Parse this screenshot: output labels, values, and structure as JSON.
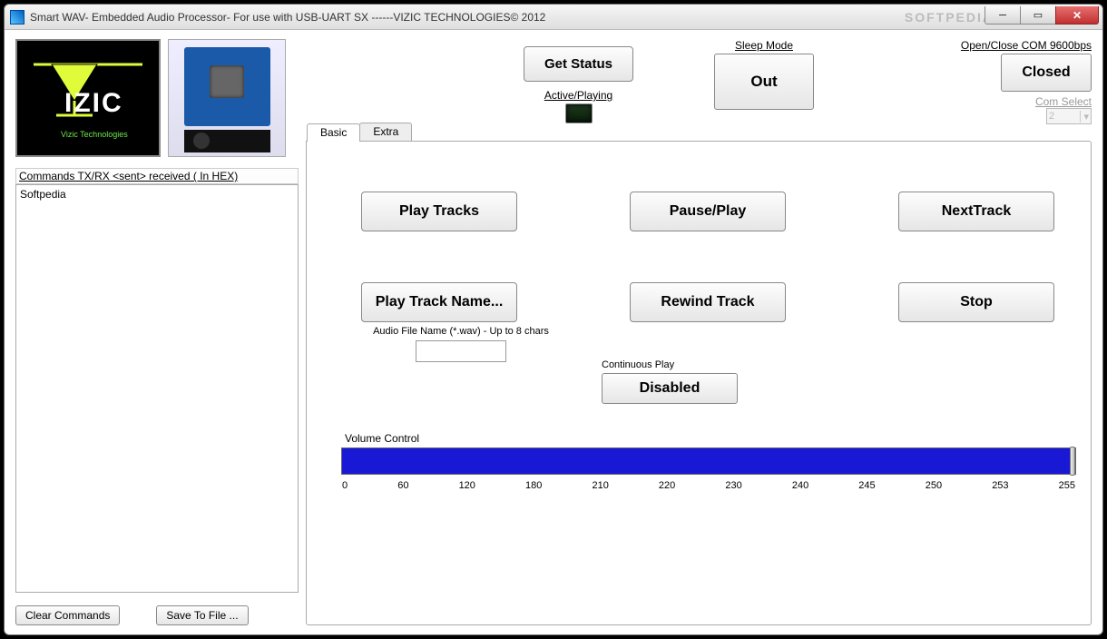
{
  "window": {
    "title": "Smart WAV- Embedded Audio Processor- For use with USB-UART SX ------VIZIC TECHNOLOGIES© 2012",
    "watermark": "SOFTPEDIA"
  },
  "logo": {
    "company_line1": "VIZIC",
    "company_line2": "Vizic Technologies"
  },
  "commands": {
    "label": "Commands TX/RX  <sent> received ( In HEX)",
    "text": "Softpedia",
    "clear_label": "Clear Commands",
    "save_label": "Save To File ..."
  },
  "top": {
    "get_status_label": "Get Status",
    "active_label": "Active/Playing",
    "sleep_mode_label": "Sleep Mode",
    "sleep_button_label": "Out",
    "com_label": "Open/Close COM 9600bps",
    "com_button_label": "Closed",
    "com_select_label": "Com Select",
    "com_select_value": "2"
  },
  "tabs": {
    "basic": "Basic",
    "extra": "Extra"
  },
  "buttons": {
    "play_tracks": "Play Tracks",
    "pause_play": "Pause/Play",
    "next_track": "NextTrack",
    "play_track_name": "Play Track Name...",
    "rewind_track": "Rewind Track",
    "stop": "Stop"
  },
  "filename": {
    "label": "Audio File Name (*.wav) - Up to 8 chars",
    "value": ""
  },
  "continuous": {
    "label": "Continuous Play",
    "button": "Disabled"
  },
  "volume": {
    "label": "Volume Control",
    "ticks": [
      "0",
      "60",
      "120",
      "180",
      "210",
      "220",
      "230",
      "240",
      "245",
      "250",
      "253",
      "255"
    ]
  }
}
